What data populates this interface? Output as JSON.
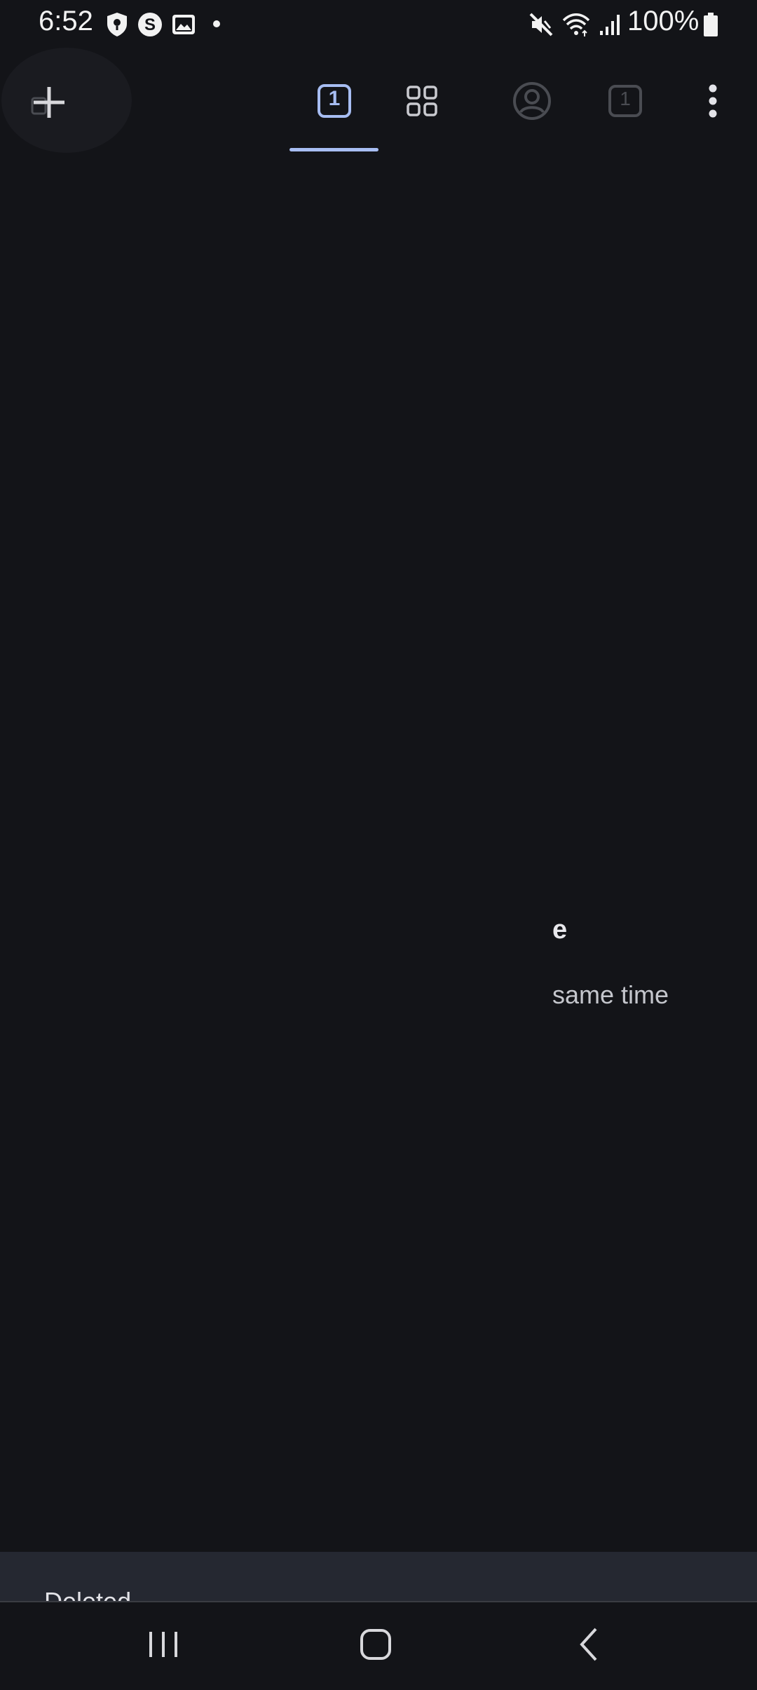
{
  "status_bar": {
    "time": "6:52",
    "battery": "100%",
    "icons": [
      "shield-pin-icon",
      "s-app-icon",
      "gallery-icon",
      "notification-dot",
      "mute-icon",
      "wifi-icon",
      "signal-icon",
      "battery-icon"
    ]
  },
  "toolbar": {
    "new_tab_icon": "plus-icon",
    "tabs": [
      {
        "name": "tab-standard",
        "count": "1",
        "selected": true
      },
      {
        "name": "tab-groups",
        "icon": "grid-icon",
        "selected": false
      },
      {
        "name": "tab-incognito-profile",
        "icon": "account-circle-icon",
        "selected": false
      },
      {
        "name": "tab-incognito",
        "count": "1",
        "selected": false
      }
    ],
    "menu_icon": "more-vert-icon",
    "accent_color": "#a7bdf2"
  },
  "empty_state": {
    "title_fragment": "e",
    "description_fragment": "same time"
  },
  "snackbar": {
    "message": "Deleted"
  },
  "nav_bar": {
    "buttons": [
      "recents-icon",
      "home-icon",
      "back-icon"
    ]
  }
}
